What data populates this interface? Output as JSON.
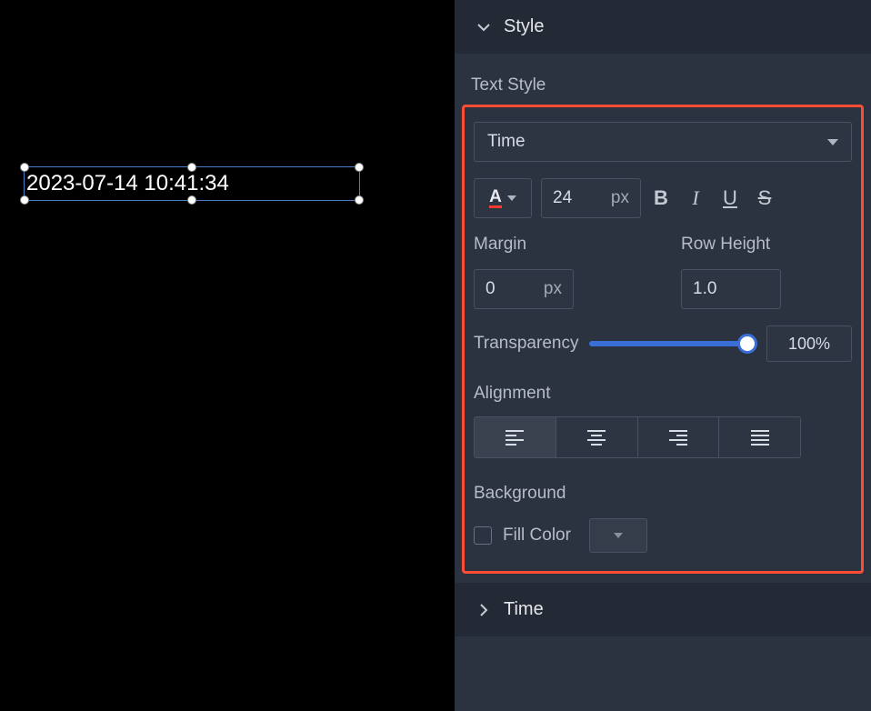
{
  "canvas": {
    "element_text": "2023-07-14 10:41:34"
  },
  "panel": {
    "style_section": "Style",
    "time_section": "Time",
    "textstyle": {
      "heading": "Text Style",
      "preset": "Time",
      "font_size": "24",
      "font_unit": "px",
      "margin_label": "Margin",
      "margin_value": "0",
      "margin_unit": "px",
      "row_height_label": "Row Height",
      "row_height_value": "1.0",
      "transparency_label": "Transparency",
      "transparency_value": "100%",
      "alignment_label": "Alignment",
      "background_label": "Background",
      "fill_color_label": "Fill Color"
    }
  }
}
